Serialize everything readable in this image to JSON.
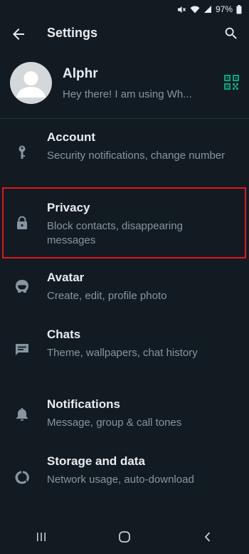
{
  "status": {
    "battery_percent": "97%",
    "icons": [
      "mute-icon",
      "wifi-icon",
      "signal-icon",
      "battery-icon"
    ]
  },
  "header": {
    "title": "Settings",
    "back_icon": "arrow-left-icon",
    "search_icon": "search-icon"
  },
  "profile": {
    "name": "Alphr",
    "status": "Hey there! I am using Wh...",
    "qr_icon": "qr-code-icon"
  },
  "settings": {
    "items": [
      {
        "title": "Account",
        "subtitle": "Security notifications, change number",
        "icon": "key-icon"
      },
      {
        "title": "Privacy",
        "subtitle": "Block contacts, disappearing messages",
        "icon": "lock-icon",
        "highlighted": true
      },
      {
        "title": "Avatar",
        "subtitle": "Create, edit, profile photo",
        "icon": "avatar-face-icon"
      },
      {
        "title": "Chats",
        "subtitle": "Theme, wallpapers, chat history",
        "icon": "chat-icon"
      },
      {
        "title": "Notifications",
        "subtitle": "Message, group & call tones",
        "icon": "bell-icon"
      },
      {
        "title": "Storage and data",
        "subtitle": "Network usage, auto-download",
        "icon": "data-usage-icon"
      }
    ]
  },
  "nav": {
    "icons": [
      "recent-apps-icon",
      "home-icon",
      "back-icon"
    ]
  },
  "colors": {
    "background": "#121b22",
    "primary_text": "#e9edef",
    "secondary_text": "#8696a0",
    "accent_green": "#00a884",
    "highlight_red": "#e2161c"
  }
}
